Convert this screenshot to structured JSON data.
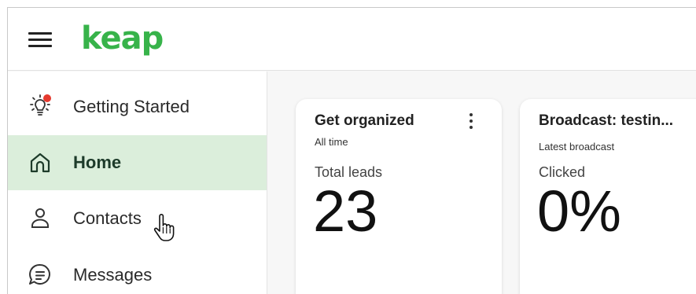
{
  "header": {
    "logo_text": "keap",
    "logo_color": "#37b34a",
    "menu_icon": "hamburger-icon"
  },
  "sidebar": {
    "active_color": "#dbeedb",
    "items": [
      {
        "label": "Getting Started",
        "icon": "lightbulb-icon",
        "notification": true,
        "active": false
      },
      {
        "label": "Home",
        "icon": "home-icon",
        "active": true
      },
      {
        "label": "Contacts",
        "icon": "person-icon",
        "active": false
      },
      {
        "label": "Messages",
        "icon": "chat-bubble-icon",
        "active": false
      }
    ]
  },
  "cards": [
    {
      "title": "Get organized",
      "subtitle": "All time",
      "metric_label": "Total leads",
      "value": "23",
      "menu_icon": "kebab-icon"
    },
    {
      "title": "Broadcast: testin...",
      "subtitle": "Latest broadcast",
      "metric_label": "Clicked",
      "value": "0%"
    }
  ],
  "notification_color": "#e53a2f"
}
